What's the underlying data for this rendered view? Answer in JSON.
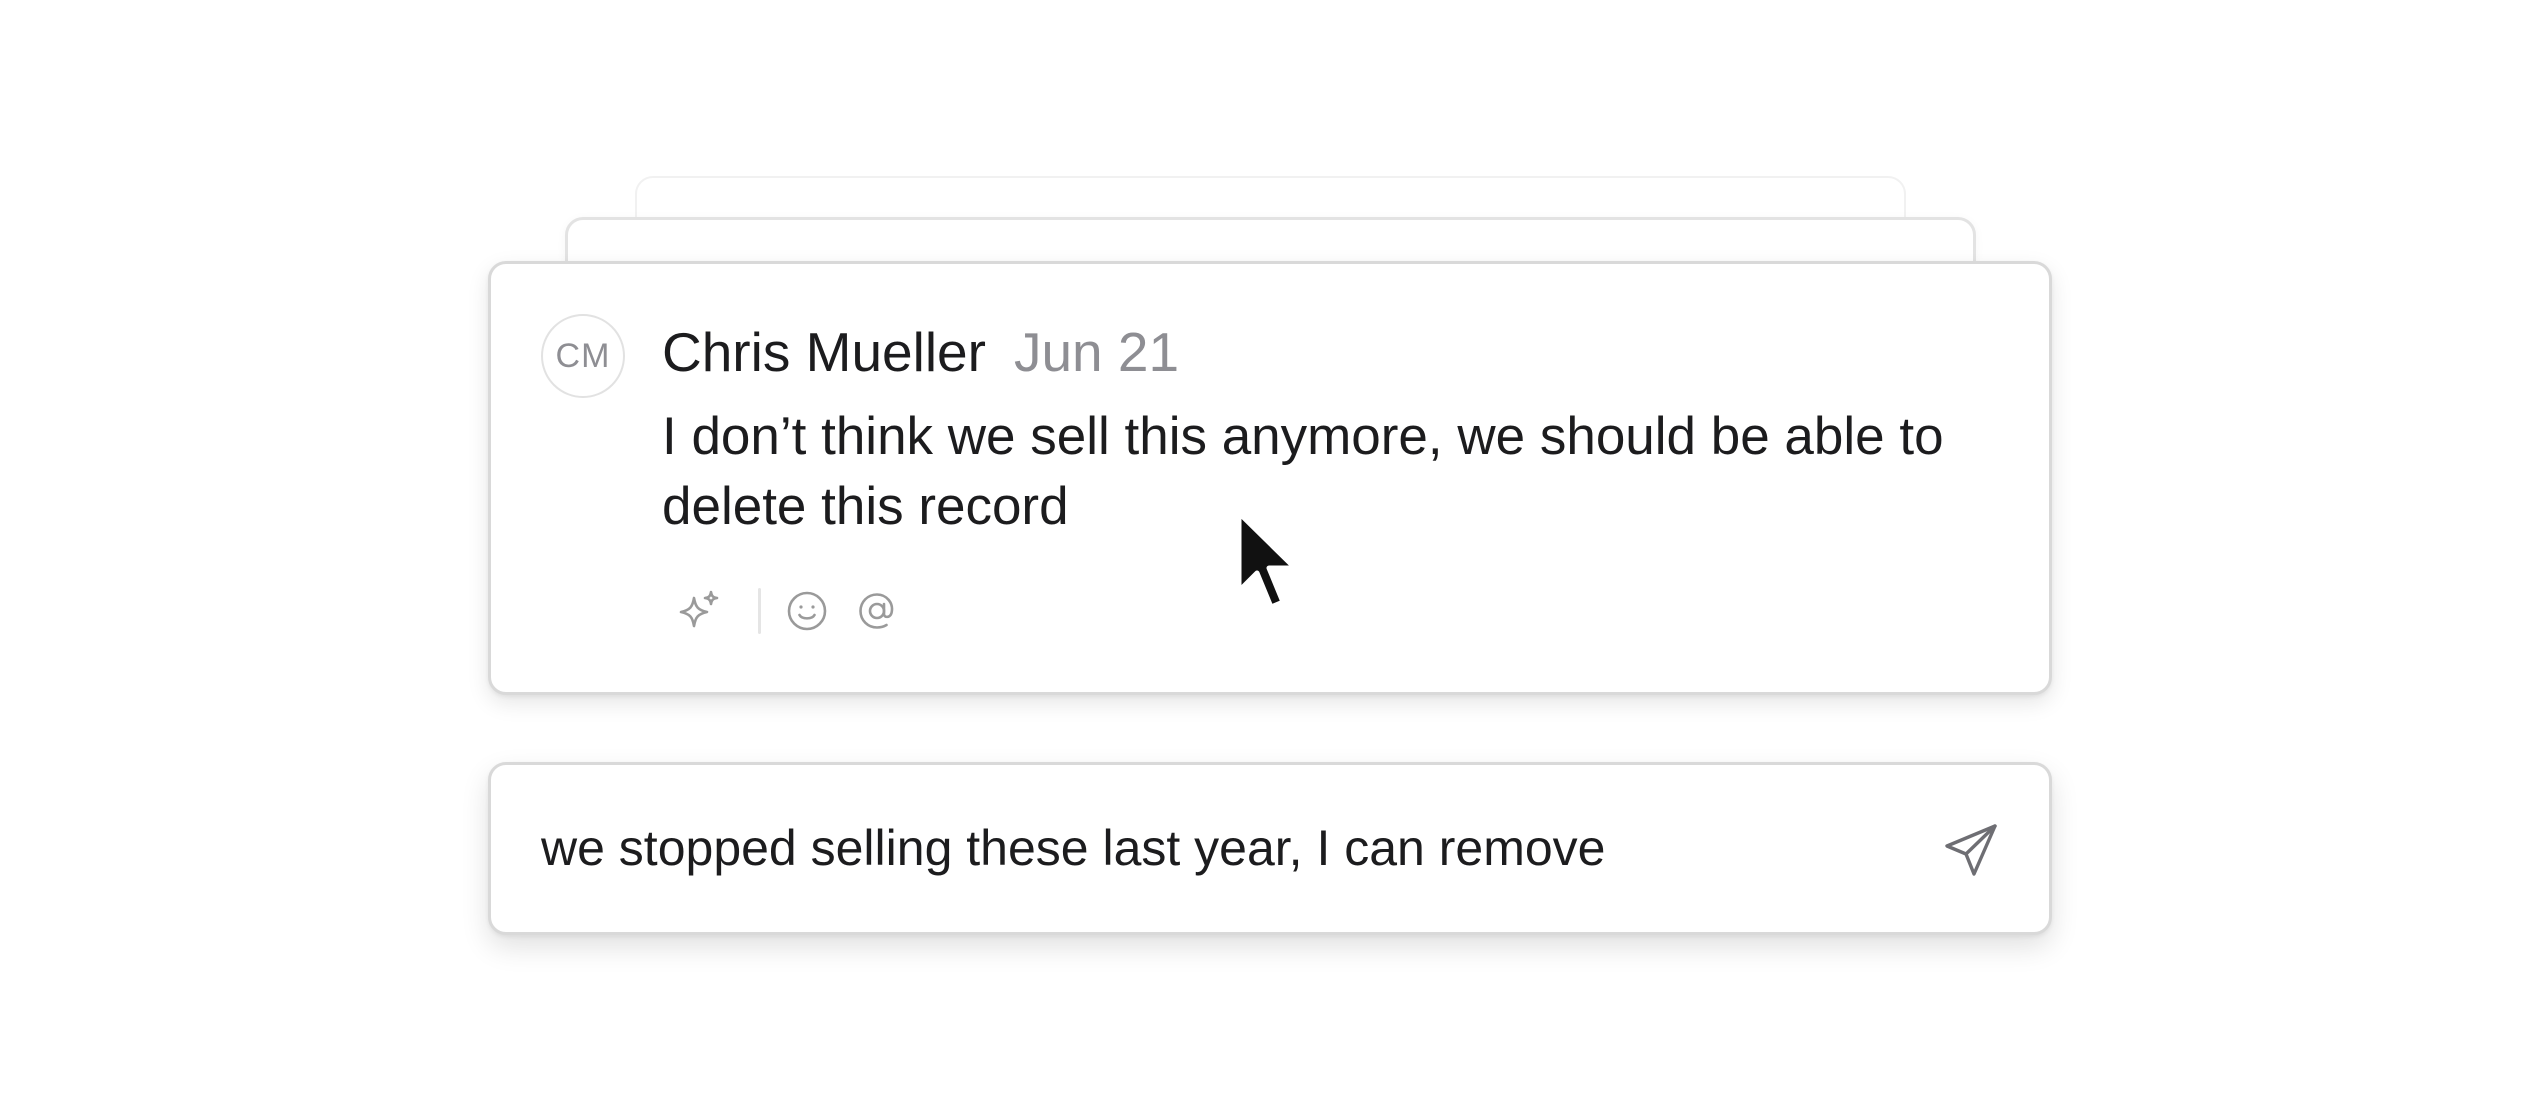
{
  "comment": {
    "avatar_initials": "CM",
    "author": "Chris Mueller",
    "date": "Jun 21",
    "message": "I don’t think we sell this anymore, we should be able to delete this record",
    "actions": [
      {
        "icon": "sparkle-icon"
      },
      {
        "icon": "emoji-icon"
      },
      {
        "icon": "mention-icon"
      }
    ]
  },
  "reply": {
    "value": "we stopped selling these last year, I can remove",
    "send_icon": "send-icon"
  },
  "colors": {
    "text": "#1c1c1e",
    "muted": "#8e8e93",
    "icon": "#9a9a9a",
    "border": "#d9d9d9"
  }
}
